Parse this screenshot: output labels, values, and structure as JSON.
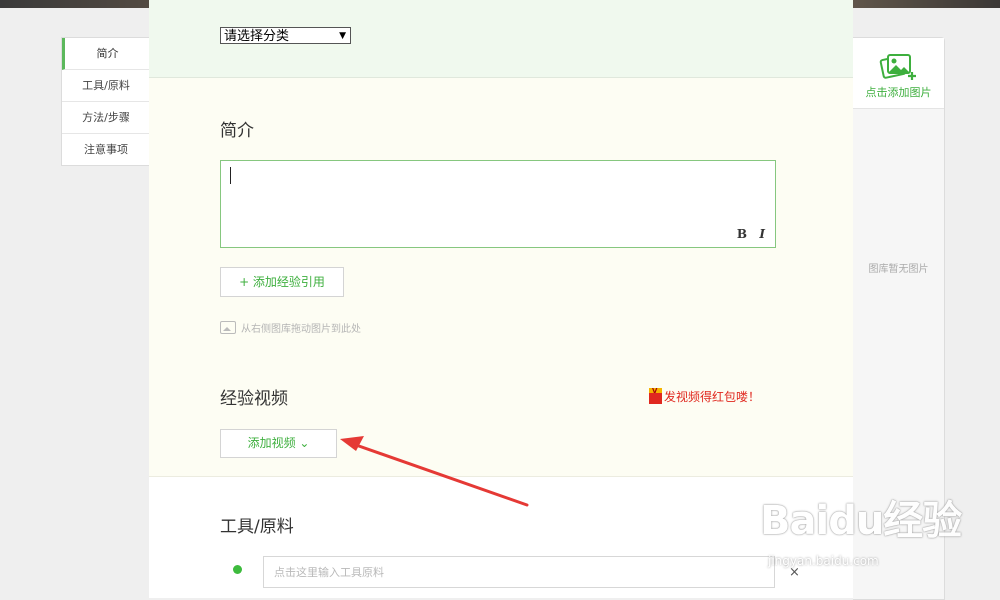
{
  "left_nav": {
    "items": [
      {
        "label": "简介",
        "active": true
      },
      {
        "label": "工具/原料",
        "active": false
      },
      {
        "label": "方法/步骤",
        "active": false
      },
      {
        "label": "注意事项",
        "active": false
      }
    ]
  },
  "category": {
    "select_value": "请选择分类"
  },
  "intro": {
    "title": "简介",
    "editor_value": "",
    "bold_label": "B",
    "italic_label": "I",
    "add_reference_label": "+ 添加经验引用",
    "drag_hint": "从右侧图库拖动图片到此处"
  },
  "video": {
    "title": "经验视频",
    "promo_text": "发视频得红包喽！",
    "add_video_label": "添加视频 ⌄"
  },
  "tools": {
    "title": "工具/原料",
    "placeholder": "点击这里输入工具原料",
    "remove_label": "×"
  },
  "gallery": {
    "add_image_label": "点击添加图片",
    "empty_text": "图库暂无图片"
  },
  "watermark": {
    "brand": "Baidu经验",
    "url": "jingyan.baidu.com"
  },
  "colors": {
    "accent_green": "#3eaf3e",
    "promo_red": "#e0281f",
    "annotation_red": "#e53935"
  }
}
